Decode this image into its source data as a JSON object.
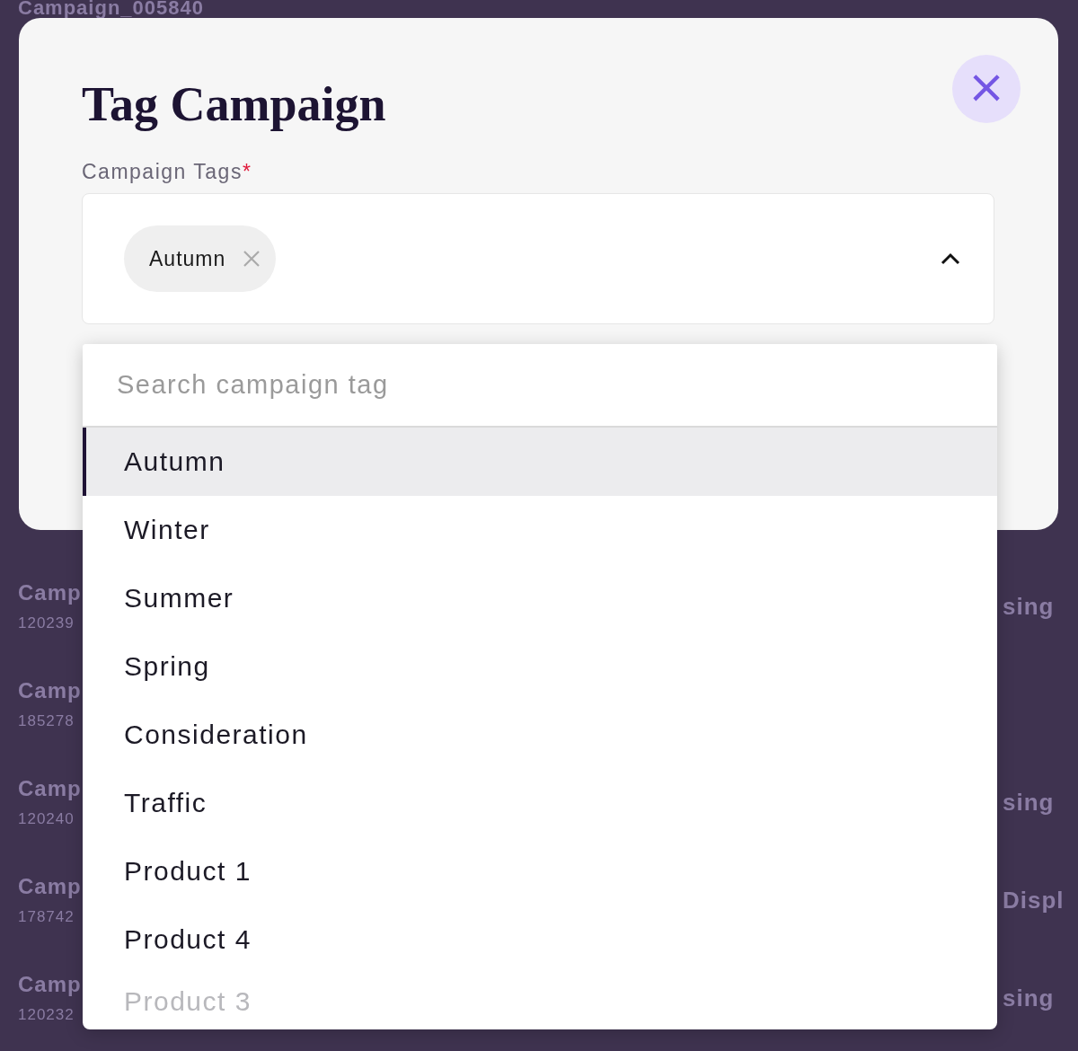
{
  "background": {
    "header": "Campaign_005840",
    "rows": [
      {
        "name": "Camp",
        "id": "120239",
        "right": "sing"
      },
      {
        "name": "Camp",
        "id": "185278"
      },
      {
        "name": "Camp",
        "id": "120240",
        "right": "sing"
      },
      {
        "name": "Camp",
        "id": "178742",
        "right": "Displ"
      },
      {
        "name": "Camp",
        "id": "120232",
        "right": "sing"
      }
    ]
  },
  "dialog": {
    "title": "Tag Campaign",
    "close": "×",
    "field": {
      "label": "Campaign Tags",
      "required_mark": "*",
      "expanded": true,
      "chips": [
        "Autumn"
      ]
    },
    "dropdown": {
      "placeholder": "Search campaign tag",
      "options": [
        {
          "label": "Autumn",
          "selected": true
        },
        {
          "label": "Winter",
          "selected": false
        },
        {
          "label": "Summer",
          "selected": false
        },
        {
          "label": "Spring",
          "selected": false
        },
        {
          "label": "Consideration",
          "selected": false
        },
        {
          "label": "Traffic",
          "selected": false
        },
        {
          "label": "Product 1",
          "selected": false
        },
        {
          "label": "Product 4",
          "selected": false
        },
        {
          "label": "Product 3",
          "selected": false
        }
      ]
    }
  }
}
